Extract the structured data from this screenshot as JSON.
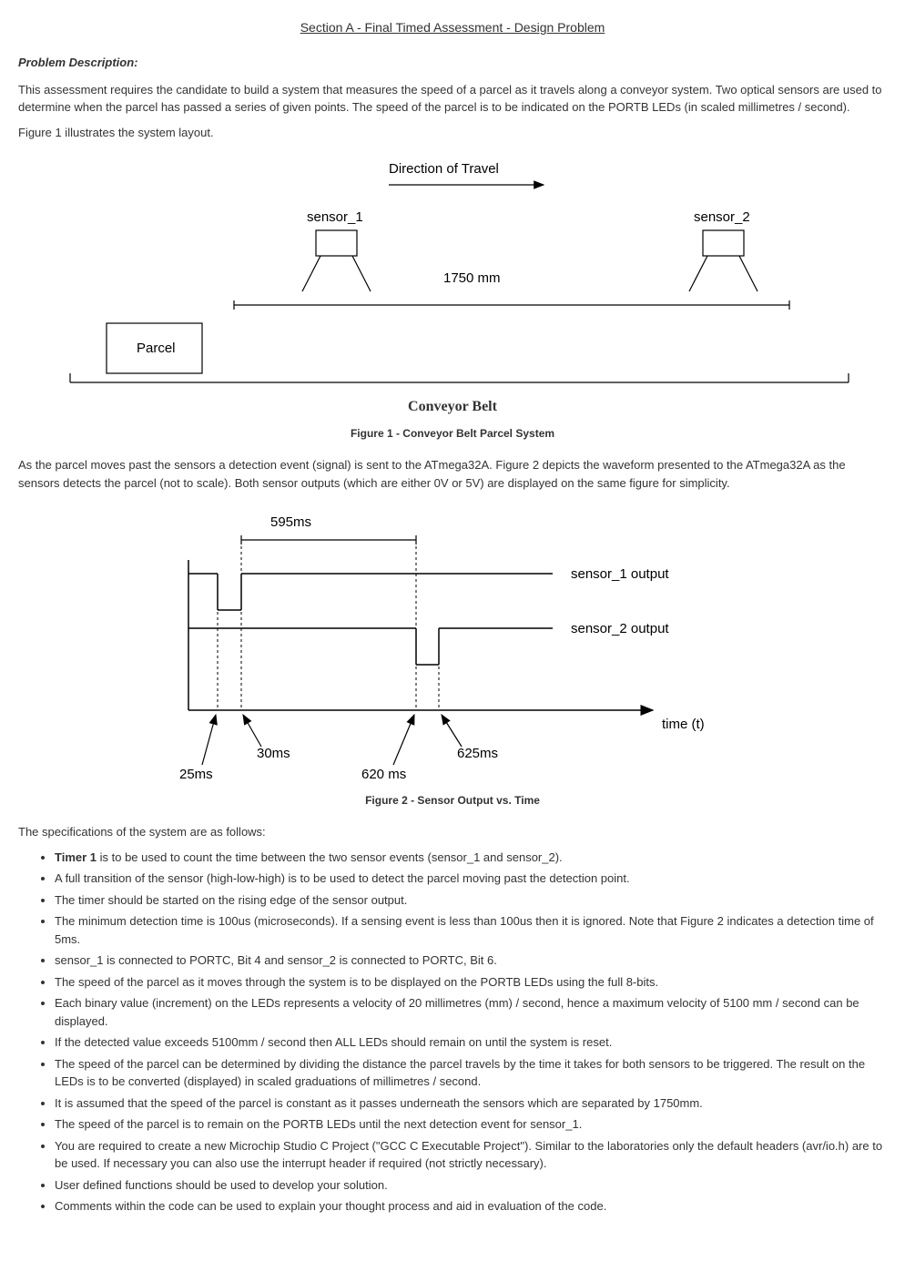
{
  "title": "Section A - Final Timed Assessment - Design Problem",
  "problem_desc_label": "Problem Description:",
  "p1": "This assessment requires the candidate to build a system that measures the speed of a parcel as it travels along a conveyor system. Two optical sensors are used to determine when the parcel has passed a series of given points. The speed of the parcel is to be indicated on the PORTB LEDs (in scaled millimetres / second).",
  "p2": "Figure 1 illustrates the system layout.",
  "fig1": {
    "direction": "Direction of Travel",
    "sensor1": "sensor_1",
    "sensor2": "sensor_2",
    "distance": "1750 mm",
    "parcel": "Parcel",
    "belt": "Conveyor Belt",
    "caption": "Figure 1 - Conveyor Belt Parcel System"
  },
  "p3": "As the parcel moves past the sensors a detection event (signal) is sent to the ATmega32A. Figure 2 depicts the waveform presented to the ATmega32A as the sensors detects the parcel (not to scale).  Both sensor outputs (which are either 0V or 5V) are displayed on the same figure for simplicity.",
  "fig2": {
    "t595": "595ms",
    "s1out": "sensor_1 output",
    "s2out": "sensor_2 output",
    "time": "time (t)",
    "t30": "30ms",
    "t625": "625ms",
    "t25": "25ms",
    "t620": "620 ms",
    "caption": "Figure 2 - Sensor Output vs. Time"
  },
  "p4": "The specifications of the system are as follows:",
  "specs": {
    "i1a": "Timer 1",
    "i1b": " is to be used to count the time between the two sensor events (sensor_1 and sensor_2).",
    "i2": "A full transition of the sensor (high-low-high) is to be used to detect the parcel moving past the detection point.",
    "i3": "The timer should be started on the rising edge of the sensor output.",
    "i4": "The minimum detection time is 100us (microseconds). If a sensing event is less than 100us then it is ignored. Note that Figure 2 indicates a detection time of 5ms.",
    "i5": "sensor_1 is connected to PORTC, Bit 4 and sensor_2 is connected to PORTC, Bit 6.",
    "i6": "The speed of the parcel as it moves through the system is to be displayed on the PORTB LEDs using the full 8-bits.",
    "i7": "Each binary value (increment) on the LEDs represents a velocity of 20 millimetres (mm) / second, hence a maximum velocity of 5100 mm / second can be displayed.",
    "i8": "If the detected value exceeds 5100mm / second then ALL LEDs should remain on until the system is reset.",
    "i9": "The speed of the parcel can be determined by dividing the distance the parcel travels by the time it takes for both sensors to be triggered. The result on the LEDs is to be converted (displayed) in scaled graduations of millimetres / second.",
    "i10": "It is assumed that the speed of the parcel is constant as it passes underneath the sensors which are separated by 1750mm.",
    "i11": "The speed of the parcel is to remain on the PORTB LEDs until the next detection event for sensor_1.",
    "i12": "You are required to create a new Microchip Studio C Project (\"GCC C Executable Project\"). Similar to the laboratories only the default headers (avr/io.h) are to be used. If necessary you can also use the interrupt header if required (not strictly necessary).",
    "i13": "User defined functions should be used to develop your solution.",
    "i14": "Comments within the code can be used to explain your thought process and aid in evaluation of the code."
  }
}
